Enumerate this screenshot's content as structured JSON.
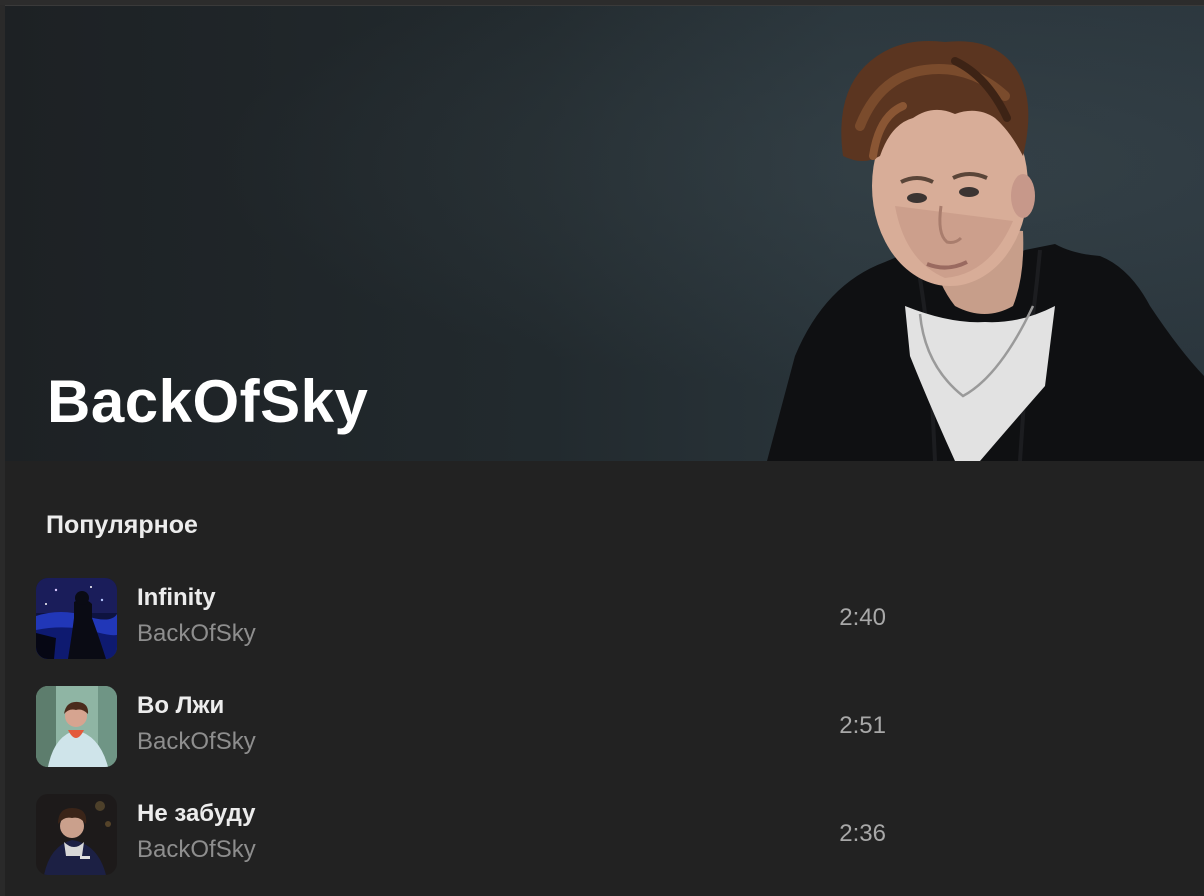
{
  "artist": {
    "name": "BackOfSky"
  },
  "popular": {
    "title": "Популярное",
    "tracks": [
      {
        "title": "Infinity",
        "artist": "BackOfSky",
        "duration": "2:40",
        "cover_icon": "night-sky-cover"
      },
      {
        "title": "Во Лжи",
        "artist": "BackOfSky",
        "duration": "2:51",
        "cover_icon": "winter-portrait-cover"
      },
      {
        "title": "Не забуду",
        "artist": "BackOfSky",
        "duration": "2:36",
        "cover_icon": "dark-portrait-cover"
      }
    ]
  },
  "colors": {
    "background": "#222222",
    "hero": "#232b30",
    "title_text": "#ffffff",
    "secondary_text": "#8e8e8e"
  }
}
